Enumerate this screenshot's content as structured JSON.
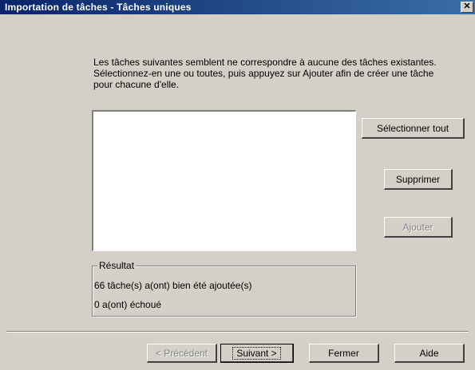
{
  "window": {
    "title": "Importation de tâches - Tâches uniques",
    "close_label": "✕"
  },
  "intro": {
    "text": "Les tâches suivantes semblent ne correspondre à aucune des tâches existantes. Sélectionnez-en une ou toutes, puis appuyez sur Ajouter afin de créer une tâche pour chacune d'elle."
  },
  "task_list": {
    "items": []
  },
  "actions": {
    "select_all": "Sélectionner tout",
    "delete": "Supprimer",
    "add": "Ajouter"
  },
  "result": {
    "legend": "Résultat",
    "added": "66 tâche(s) a(ont) bien été ajoutée(s)",
    "failed": "0 a(ont) échoué"
  },
  "footer": {
    "previous": "< Précédent",
    "next": "Suivant >",
    "close": "Fermer",
    "help": "Aide"
  }
}
